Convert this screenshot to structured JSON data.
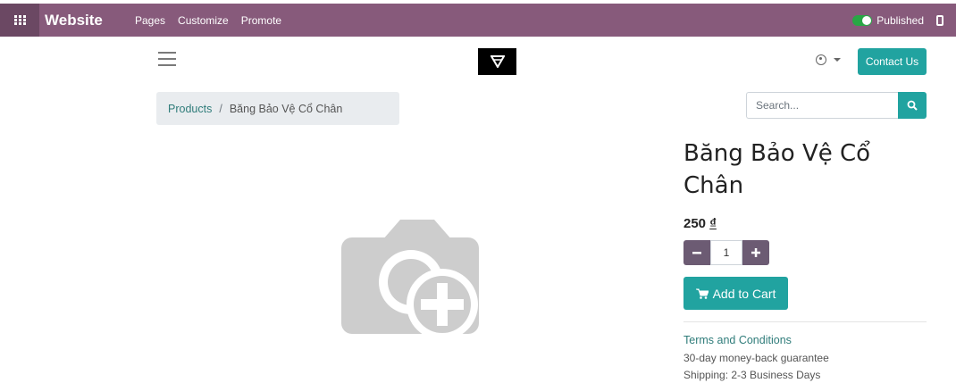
{
  "admin_bar": {
    "brand": "Website",
    "menu": [
      "Pages",
      "Customize",
      "Promote"
    ],
    "published_label": "Published",
    "color": "#875a7b",
    "icons": [
      "apps-grid-icon",
      "toggle-switch-icon",
      "mobile-preview-icon"
    ]
  },
  "header": {
    "icons": [
      "hamburger-menu-icon",
      "logo-icon",
      "user-icon",
      "caret-down-icon"
    ],
    "contact_label": "Contact Us",
    "accent": "#21a3a0"
  },
  "breadcrumb": {
    "root": "Products",
    "separator": "/",
    "current": "Băng Bảo Vệ Cổ Chân"
  },
  "search": {
    "placeholder": "Search...",
    "icon": "search-icon"
  },
  "product": {
    "title": "Băng Bảo Vệ Cổ Chân",
    "price": "250",
    "currency": "₫",
    "quantity": "1",
    "image_icon": "camera-add-placeholder-icon",
    "add_to_cart_label": "Add to Cart",
    "terms_label": "Terms and Conditions",
    "guarantee": "30-day money-back guarantee",
    "shipping": "Shipping: 2-3 Business Days"
  }
}
